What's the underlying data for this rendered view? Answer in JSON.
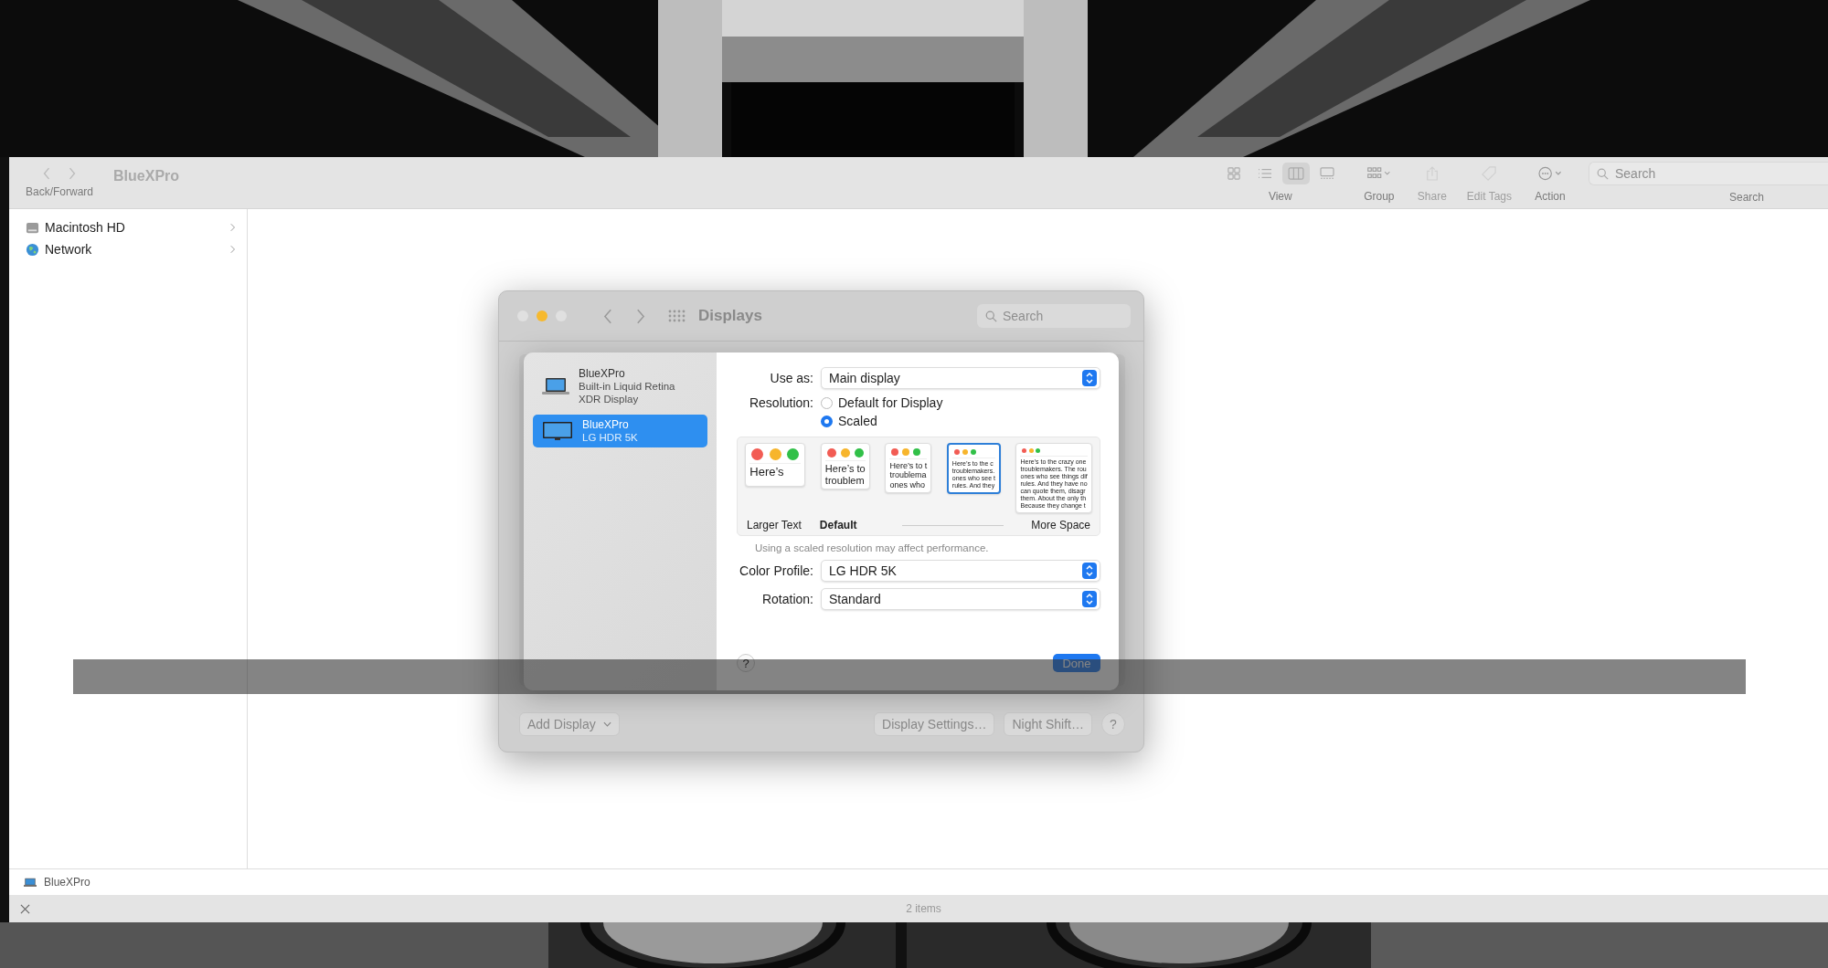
{
  "finder": {
    "nav_label": "Back/Forward",
    "title": "BlueXPro",
    "views": [
      {
        "selected": false
      },
      {
        "selected": false
      },
      {
        "selected": true
      },
      {
        "selected": false
      }
    ],
    "view_label": "View",
    "tools": [
      {
        "kind": "group",
        "label": "Group",
        "disabled": false
      },
      {
        "kind": "share",
        "label": "Share",
        "disabled": true
      },
      {
        "kind": "tags",
        "label": "Edit Tags",
        "disabled": true
      },
      {
        "kind": "action",
        "label": "Action",
        "disabled": false
      }
    ],
    "search": {
      "placeholder": "Search",
      "label": "Search"
    },
    "sidebar": [
      {
        "kind": "disk",
        "label": "Macintosh HD"
      },
      {
        "kind": "network",
        "label": "Network"
      }
    ],
    "path_bar": "BlueXPro",
    "status": "2 items"
  },
  "displays_window": {
    "title": "Displays",
    "search_placeholder": "Search",
    "displays": [
      {
        "kind": "laptop",
        "name": "BlueXPro",
        "description": "Built-in Liquid Retina XDR Display",
        "selected": false
      },
      {
        "kind": "monitor",
        "name": "BlueXPro",
        "description": "LG HDR 5K",
        "selected": true
      }
    ],
    "use_as": {
      "label": "Use as:",
      "value": "Main display"
    },
    "resolution": {
      "label": "Resolution:",
      "options": [
        {
          "label": "Default for Display",
          "selected": false
        },
        {
          "label": "Scaled",
          "selected": true
        }
      ]
    },
    "scales": [
      {
        "label": "Larger Text",
        "default": false,
        "selected": false,
        "lines": [
          "Here’s"
        ]
      },
      {
        "label": "Default",
        "default": true,
        "selected": false,
        "lines": [
          "Here’s to",
          "troublem"
        ]
      },
      {
        "selected": false,
        "lines": [
          "Here’s to t",
          "troublema",
          "ones who"
        ]
      },
      {
        "selected": true,
        "lines": [
          "Here’s to the c",
          "troublemakers.",
          "ones who see t",
          "rules. And they"
        ]
      },
      {
        "label": "More Space",
        "default": false,
        "selected": false,
        "lines": [
          "Here’s to the crazy one",
          "troublemakers. The rou",
          "ones who see things dif",
          "rules. And they have no",
          "can quote them, disagr",
          "them. About the only th",
          "Because they change t"
        ]
      }
    ],
    "note": "Using a scaled resolution may affect performance.",
    "color_profile": {
      "label": "Color Profile:",
      "value": "LG HDR 5K"
    },
    "rotation": {
      "label": "Rotation:",
      "value": "Standard"
    },
    "help": "?",
    "done": "Done",
    "add_display": "Add Display",
    "display_settings": "Display Settings…",
    "night_shift": "Night Shift…",
    "window_help": "?"
  }
}
